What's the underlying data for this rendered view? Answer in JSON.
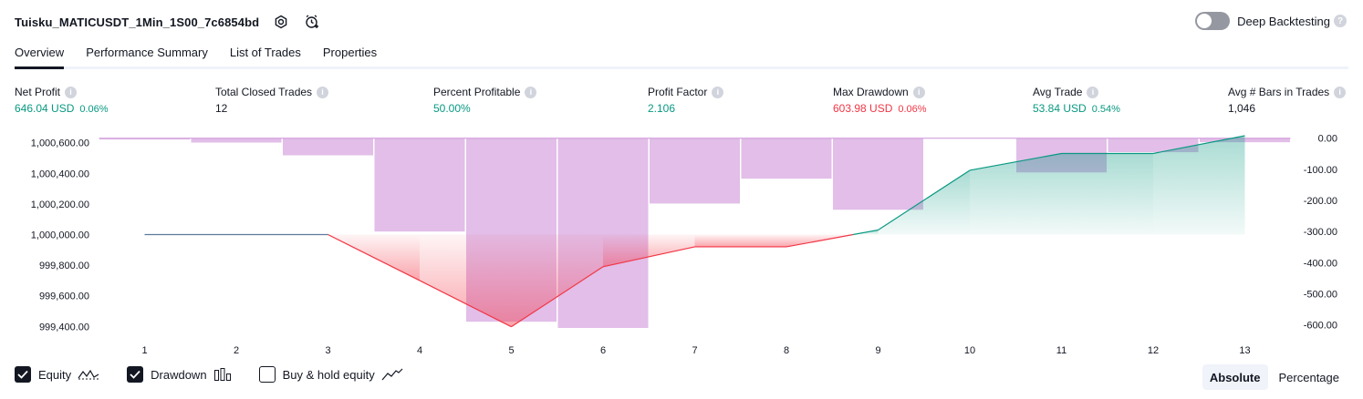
{
  "header": {
    "strategy_name": "Tuisku_MATICUSDT_1Min_1S00_7c6854bd",
    "icons": [
      "gear-icon",
      "alarm-add-icon"
    ]
  },
  "deep_backtesting": {
    "label": "Deep Backtesting",
    "enabled": false,
    "help": "?"
  },
  "tabs": [
    {
      "label": "Overview",
      "active": true
    },
    {
      "label": "Performance Summary",
      "active": false
    },
    {
      "label": "List of Trades",
      "active": false
    },
    {
      "label": "Properties",
      "active": false
    }
  ],
  "metrics": {
    "net_profit": {
      "label": "Net Profit",
      "value": "646.04 USD",
      "pct": "0.06%"
    },
    "total_closed_trades": {
      "label": "Total Closed Trades",
      "value": "12"
    },
    "percent_profitable": {
      "label": "Percent Profitable",
      "value": "50.00%"
    },
    "profit_factor": {
      "label": "Profit Factor",
      "value": "2.106"
    },
    "max_drawdown": {
      "label": "Max Drawdown",
      "value": "603.98 USD",
      "pct": "0.06%"
    },
    "avg_trade": {
      "label": "Avg Trade",
      "value": "53.84 USD",
      "pct": "0.54%"
    },
    "avg_bars": {
      "label": "Avg # Bars in Trades",
      "value": "1,046"
    }
  },
  "chart_data": {
    "type": "line",
    "x": [
      1,
      2,
      3,
      4,
      5,
      6,
      7,
      8,
      9,
      10,
      11,
      12,
      13
    ],
    "x_tick_labels": [
      "1",
      "2",
      "3",
      "4",
      "5",
      "6",
      "7",
      "8",
      "9",
      "10",
      "11",
      "12",
      "13"
    ],
    "left_axis": {
      "ticks": [
        "1,000,600.00",
        "1,000,400.00",
        "1,000,200.00",
        "1,000,000.00",
        "999,800.00",
        "999,600.00",
        "999,400.00"
      ],
      "ylim": [
        999390,
        1000640
      ]
    },
    "right_axis": {
      "ticks": [
        "0.00",
        "-100.00",
        "-200.00",
        "-300.00",
        "-400.00",
        "-500.00",
        "-600.00"
      ],
      "ylim": [
        -610,
        5
      ]
    },
    "series": [
      {
        "name": "Equity",
        "type": "line",
        "axis": "left",
        "values": [
          1000000,
          1000000,
          1000000,
          999700,
          999398,
          999790,
          999920,
          999920,
          1000030,
          1000420,
          1000530,
          1000530,
          1000646
        ]
      },
      {
        "name": "Drawdown",
        "type": "bar",
        "axis": "right",
        "values": [
          -2,
          -14,
          -55,
          -300,
          -590,
          -610,
          -210,
          -130,
          -230,
          null,
          -110,
          -45,
          -13
        ]
      }
    ],
    "equity_color_up": "#089981",
    "equity_color_down": "#f23645",
    "drawdown_color": "#ce93d8",
    "grid": false
  },
  "legend": {
    "items": [
      {
        "label": "Equity",
        "checked": true,
        "icon": "equity-line-icon"
      },
      {
        "label": "Drawdown",
        "checked": true,
        "icon": "drawdown-bars-icon"
      },
      {
        "label": "Buy & hold equity",
        "checked": false,
        "icon": "buy-hold-line-icon"
      }
    ]
  },
  "mode": {
    "absolute": "Absolute",
    "percentage": "Percentage",
    "selected": "Absolute"
  }
}
